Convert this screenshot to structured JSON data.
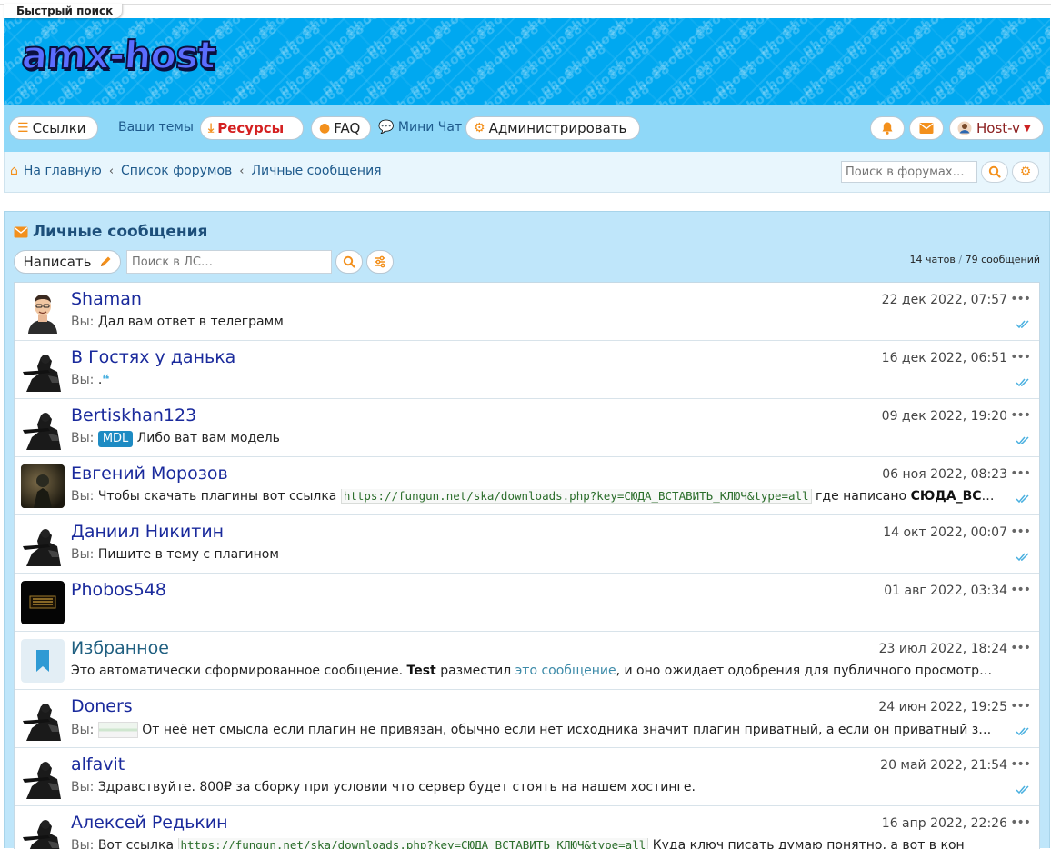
{
  "quick_search": "Быстрый поиск",
  "logo": "amx-host",
  "watermark": "pho88",
  "nav": {
    "links": "Ссылки",
    "your_topics": "Ваши темы",
    "resources": "Ресурсы",
    "faq": "FAQ",
    "mini_chat": "Мини Чат",
    "admin": "Администрировать",
    "user": "Host-v"
  },
  "breadcrumbs": [
    "На главную",
    "Список форумов",
    "Личные сообщения"
  ],
  "forum_search_placeholder": "Поиск в форумах…",
  "block": {
    "title": "Личные сообщения",
    "write": "Написать",
    "pm_search_placeholder": "Поиск в ЛС…",
    "chats": "14 чатов",
    "messages": "79 сообщений"
  },
  "conversations": [
    {
      "name": "Shaman",
      "date": "22 дек 2022, 07:57",
      "you": "Вы:",
      "text": "Дал вам ответ в телеграмм"
    },
    {
      "name": "В Гостях у данька",
      "date": "16 дек 2022, 06:51",
      "you": "Вы:",
      "text": "."
    },
    {
      "name": "Bertiskhan123",
      "date": "09 дек 2022, 19:20",
      "you": "Вы:",
      "tag": "MDL",
      "text": "Либо ват вам модель"
    },
    {
      "name": "Евгений Морозов",
      "date": "06 ноя 2022, 08:23",
      "you": "Вы:",
      "text": "Чтобы скачать плагины вот ссылка",
      "code": "https://fungun.net/ska/downloads.php?key=СЮДА_ВСТАВИТЬ_КЛЮЧ&type=all",
      "text2": "где написано",
      "bold": "СЮДА_ВСТАВИТЬ_КЛЮЧ"
    },
    {
      "name": "Даниил Никитин",
      "date": "14 окт 2022, 00:07",
      "you": "Вы:",
      "text": "Пишите в тему с плагином"
    },
    {
      "name": "Phobos548",
      "date": "01 авг 2022, 03:34"
    },
    {
      "name": "Избранное",
      "date": "23 июл 2022, 18:24",
      "text": "Это автоматически сформированное сообщение.",
      "bold": "Test",
      "text2": "разместил",
      "link": "это сообщение",
      "text3": ", и оно ожидает одобрения для публичного просмотра модератором."
    },
    {
      "name": "Doners",
      "date": "24 июн 2022, 19:25",
      "you": "Вы:",
      "text": "От неё нет смысла если плагин не привязан, обычно если нет исходника значит плагин приватный, а если он приватный значит"
    },
    {
      "name": "alfavit",
      "date": "20 май 2022, 21:54",
      "you": "Вы:",
      "text": "Здравствуйте. 800₽ за сборку при условии что сервер будет стоять на нашем хостинге."
    },
    {
      "name": "Алексей Редькин",
      "date": "16 апр 2022, 22:26",
      "you": "Вы:",
      "text": "Вот ссылка",
      "code": "https://fungun.net/ska/downloads.php?key=СЮДА_ВСТАВИТЬ_КЛЮЧ&type=all",
      "text2": "Куда ключ писать думаю понятно, а вот в кон"
    }
  ],
  "colors": {
    "banner": "#00a8f0",
    "navbar": "#8fd8f8",
    "accent": "#f3901c",
    "name": "#1a2a9c"
  }
}
